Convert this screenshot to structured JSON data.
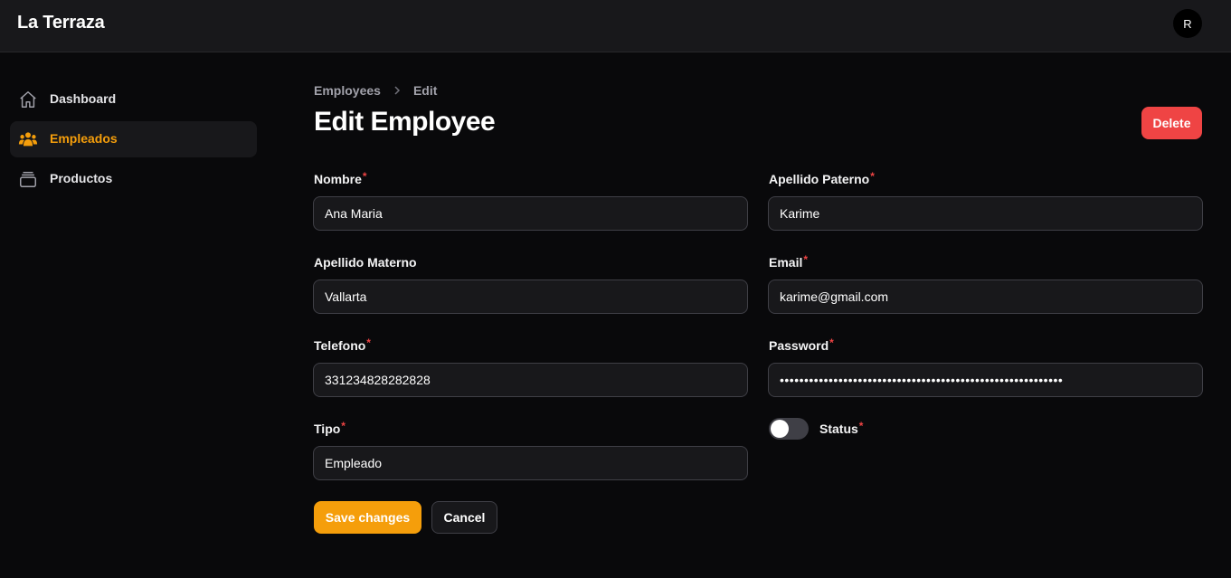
{
  "app": {
    "title": "La Terraza",
    "avatar_initial": "R"
  },
  "sidebar": {
    "items": [
      {
        "label": "Dashboard",
        "icon": "home-icon",
        "active": false
      },
      {
        "label": "Empleados",
        "icon": "users-icon",
        "active": true
      },
      {
        "label": "Productos",
        "icon": "archive-icon",
        "active": false
      }
    ]
  },
  "breadcrumb": {
    "items": [
      "Employees",
      "Edit"
    ]
  },
  "page": {
    "title": "Edit Employee"
  },
  "actions": {
    "delete": "Delete",
    "save": "Save changes",
    "cancel": "Cancel"
  },
  "form": {
    "nombre": {
      "label": "Nombre",
      "value": "Ana Maria",
      "required": true
    },
    "apellido_paterno": {
      "label": "Apellido Paterno",
      "value": "Karime",
      "required": true
    },
    "apellido_materno": {
      "label": "Apellido Materno",
      "value": "Vallarta",
      "required": false
    },
    "email": {
      "label": "Email",
      "value": "karime@gmail.com",
      "required": true
    },
    "telefono": {
      "label": "Telefono",
      "value": "331234828282828",
      "required": true
    },
    "password": {
      "label": "Password",
      "value": "••••••••••••••••••••••••••••••••••••••••••••••••••••••••••",
      "required": true
    },
    "tipo": {
      "label": "Tipo",
      "value": "Empleado",
      "required": true
    },
    "status": {
      "label": "Status",
      "enabled": false,
      "required": true
    }
  },
  "colors": {
    "accent": "#f59e0b",
    "danger": "#ef4444",
    "background": "#09090b",
    "surface": "#18181b"
  }
}
